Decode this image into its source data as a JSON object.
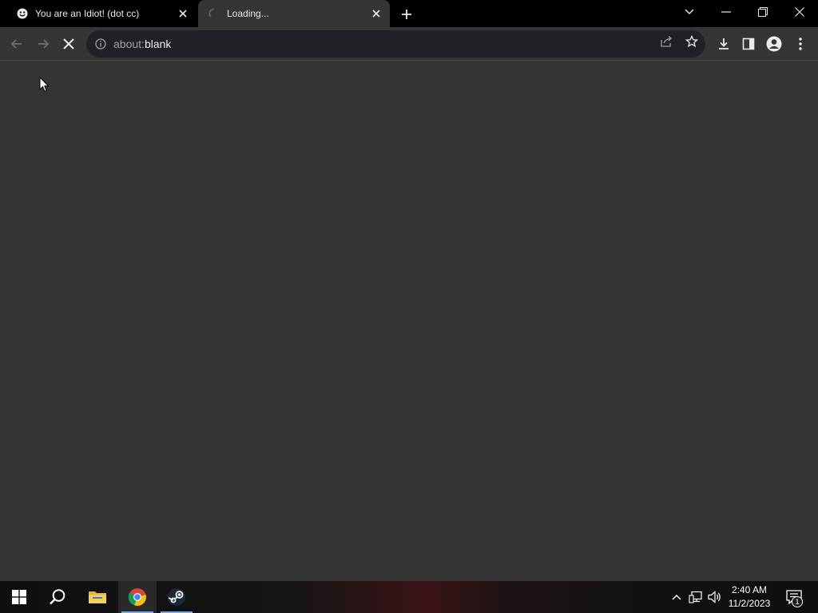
{
  "browser": {
    "tabs": [
      {
        "title": "You are an Idiot! (dot cc)",
        "favicon": "smiley-icon",
        "active": false
      },
      {
        "title": "Loading...",
        "favicon": "loading-spinner-icon",
        "active": true
      }
    ],
    "address_bar": {
      "scheme": "about:",
      "host": "blank"
    }
  },
  "taskbar": {
    "clock_time": "2:40 AM",
    "clock_date": "11/2/2023",
    "notification_count": "1"
  },
  "colors": {
    "tabstrip": "#000000",
    "toolbar": "#353535",
    "omnibox": "#202124",
    "content": "#353535",
    "taskbar": "#0e0e0e"
  }
}
